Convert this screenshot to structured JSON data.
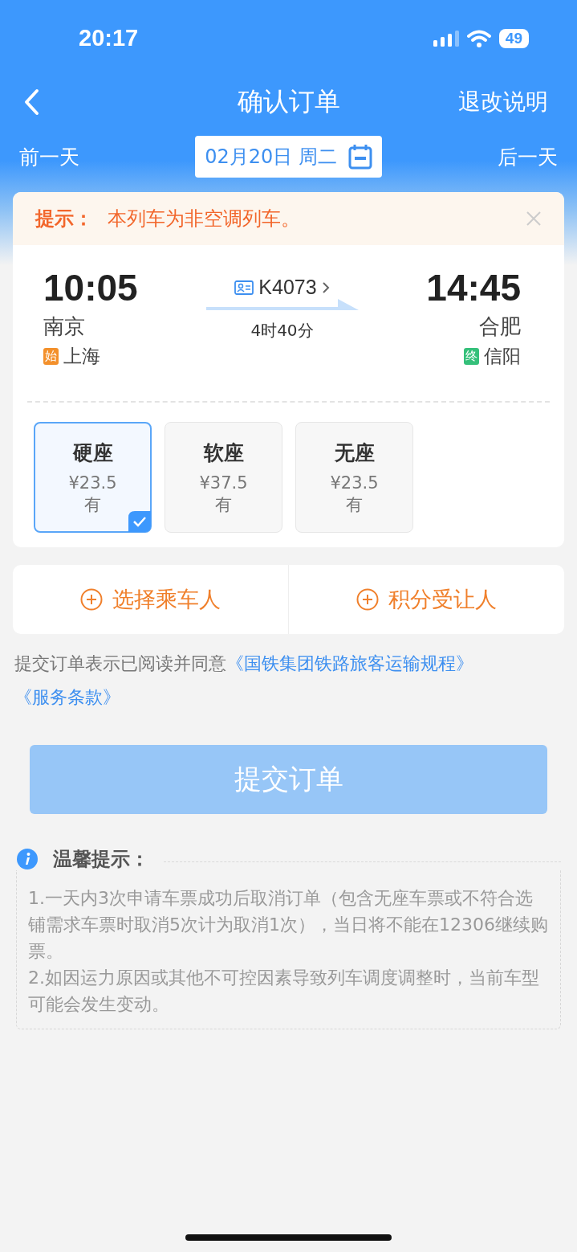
{
  "status_bar": {
    "time": "20:17",
    "battery": "49"
  },
  "nav": {
    "title": "确认订单",
    "right_link": "退改说明"
  },
  "date_bar": {
    "prev": "前一天",
    "date": "02月20日 周二",
    "next": "后一天"
  },
  "notice": {
    "label": "提示：",
    "text": "本列车为非空调列车。"
  },
  "train": {
    "depart_time": "10:05",
    "depart_station": "南京",
    "origin_badge": "始",
    "origin": "上海",
    "train_no": "K4073",
    "duration": "4时40分",
    "arrive_time": "14:45",
    "arrive_station": "合肥",
    "terminal_badge": "终",
    "terminal": "信阳"
  },
  "seats": [
    {
      "name": "硬座",
      "price": "¥23.5",
      "availability": "有",
      "selected": true
    },
    {
      "name": "软座",
      "price": "¥37.5",
      "availability": "有",
      "selected": false
    },
    {
      "name": "无座",
      "price": "¥23.5",
      "availability": "有",
      "selected": false
    }
  ],
  "actions": [
    {
      "label": "选择乘车人"
    },
    {
      "label": "积分受让人"
    }
  ],
  "agreement": {
    "text": "提交订单表示已阅读并同意",
    "links": [
      "《国铁集团铁路旅客运输规程》",
      "《服务条款》"
    ]
  },
  "submit": {
    "label": "提交订单",
    "disabled": true
  },
  "tips": {
    "title": "温馨提示：",
    "items": [
      "1.一天内3次申请车票成功后取消订单（包含无座车票或不符合选铺需求车票时取消5次计为取消1次），当日将不能在12306继续购票。",
      "2.如因运力原因或其他不可控因素导致列车调度调整时，当前车型可能会发生变动。"
    ]
  }
}
